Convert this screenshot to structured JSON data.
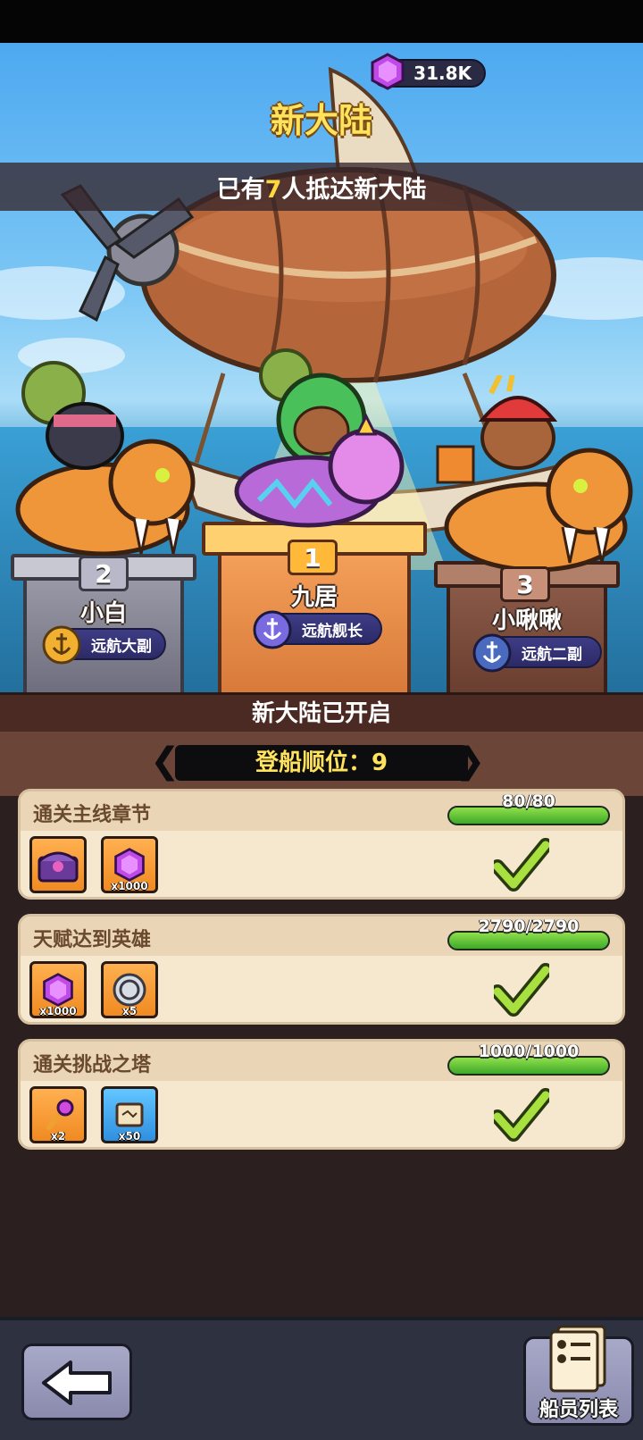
{
  "header": {
    "gem_count": "31.8K",
    "title": "新大陆",
    "arrival_prefix": "已有",
    "arrival_count": "7",
    "arrival_suffix": "人抵达新大陆"
  },
  "podium": [
    {
      "rank": "1",
      "name": "九居",
      "title": "远航舰长"
    },
    {
      "rank": "2",
      "name": "小白",
      "title": "远航大副"
    },
    {
      "rank": "3",
      "name": "小啾啾",
      "title": "远航二副"
    }
  ],
  "status": {
    "opened_text": "新大陆已开启",
    "boarding_order": "登船顺位：9"
  },
  "tasks": [
    {
      "name": "通关主线章节",
      "progress": "80/80",
      "progress_fraction": 1.0,
      "completed": true,
      "rewards": [
        {
          "icon": "purple-chest-icon",
          "quantity": ""
        },
        {
          "icon": "purple-gem-icon",
          "quantity": "x1000"
        }
      ]
    },
    {
      "name": "天赋达到英雄",
      "progress": "2790/2790",
      "progress_fraction": 1.0,
      "completed": true,
      "rewards": [
        {
          "icon": "purple-gem-icon",
          "quantity": "x1000"
        },
        {
          "icon": "silver-coin-icon",
          "quantity": "x5"
        }
      ]
    },
    {
      "name": "通关挑战之塔",
      "progress": "1000/1000",
      "progress_fraction": 1.0,
      "completed": true,
      "rewards": [
        {
          "icon": "magic-key-icon",
          "quantity": "x2"
        },
        {
          "icon": "treasure-map-icon",
          "quantity": "x50"
        }
      ]
    }
  ],
  "footer": {
    "back_icon": "back-arrow-icon",
    "crew_list_label": "船员列表"
  },
  "colors": {
    "title_yellow": "#ffe35c",
    "progress_green": "#3fa82a",
    "card_bg": "#f6e8cf",
    "dark_bg": "#2c1f1f"
  }
}
